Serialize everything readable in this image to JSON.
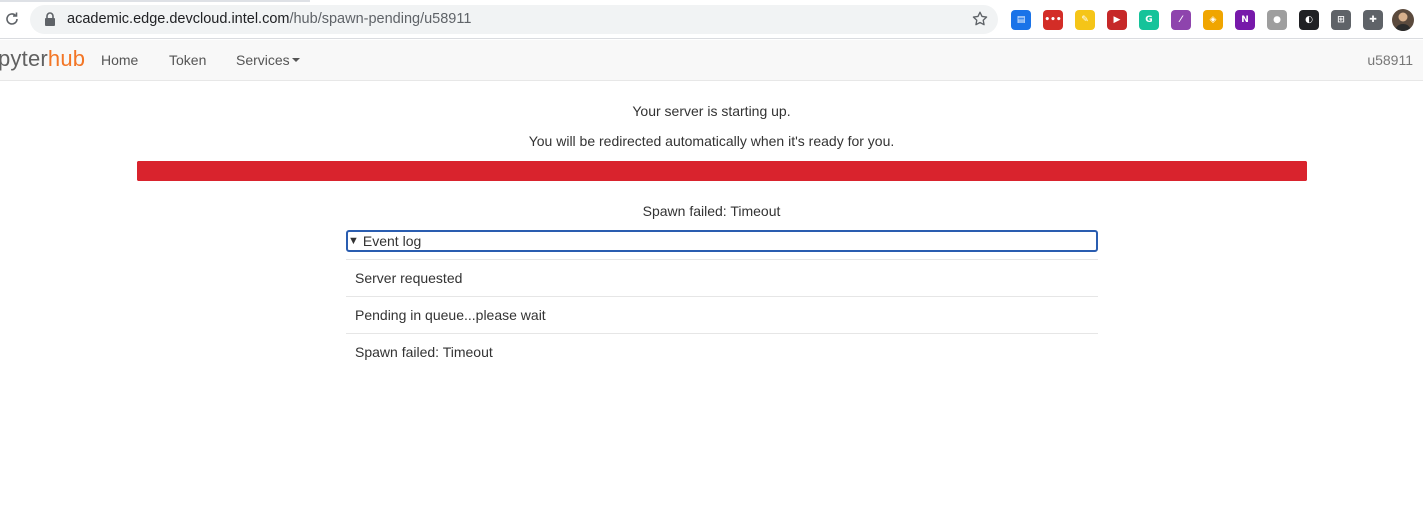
{
  "browser": {
    "url_host": "academic.edge.devcloud.intel.com",
    "url_path": "/hub/spawn-pending/u58911",
    "extensions": [
      {
        "name": "calendar-extension-icon",
        "color": "#1a73e8",
        "glyph": "▤"
      },
      {
        "name": "lastpass-extension-icon",
        "color": "#d32d27",
        "glyph": "•••"
      },
      {
        "name": "yellow-extension-icon",
        "color": "#f5c518",
        "glyph": "✎"
      },
      {
        "name": "red-play-extension-icon",
        "color": "#c62828",
        "glyph": "▶"
      },
      {
        "name": "grammarly-extension-icon",
        "color": "#15c39a",
        "glyph": "G"
      },
      {
        "name": "feather-extension-icon",
        "color": "#8e44ad",
        "glyph": "⁄"
      },
      {
        "name": "shield-extension-icon",
        "color": "#f0a500",
        "glyph": "◈"
      },
      {
        "name": "onenote-extension-icon",
        "color": "#7719aa",
        "glyph": "N"
      },
      {
        "name": "circle-extension-icon",
        "color": "#9e9e9e",
        "glyph": "●"
      },
      {
        "name": "ghost-extension-icon",
        "color": "#202124",
        "glyph": "◐"
      },
      {
        "name": "grid-extension-icon",
        "color": "#5f6368",
        "glyph": "⊞"
      },
      {
        "name": "puzzle-extensions-icon",
        "color": "#5f6368",
        "glyph": "✚"
      }
    ]
  },
  "navbar": {
    "logo_a": "pyter",
    "logo_b": "hub",
    "home": "Home",
    "token": "Token",
    "services": "Services",
    "user": "u58911"
  },
  "main": {
    "starting": "Your server is starting up.",
    "redirect": "You will be redirected automatically when it's ready for you.",
    "progress_percent": 100,
    "progress_color": "#d9232d",
    "failed": "Spawn failed: Timeout",
    "event_log_label": "Event log",
    "events": [
      "Server requested",
      "Pending in queue...please wait",
      "Spawn failed: Timeout"
    ]
  }
}
